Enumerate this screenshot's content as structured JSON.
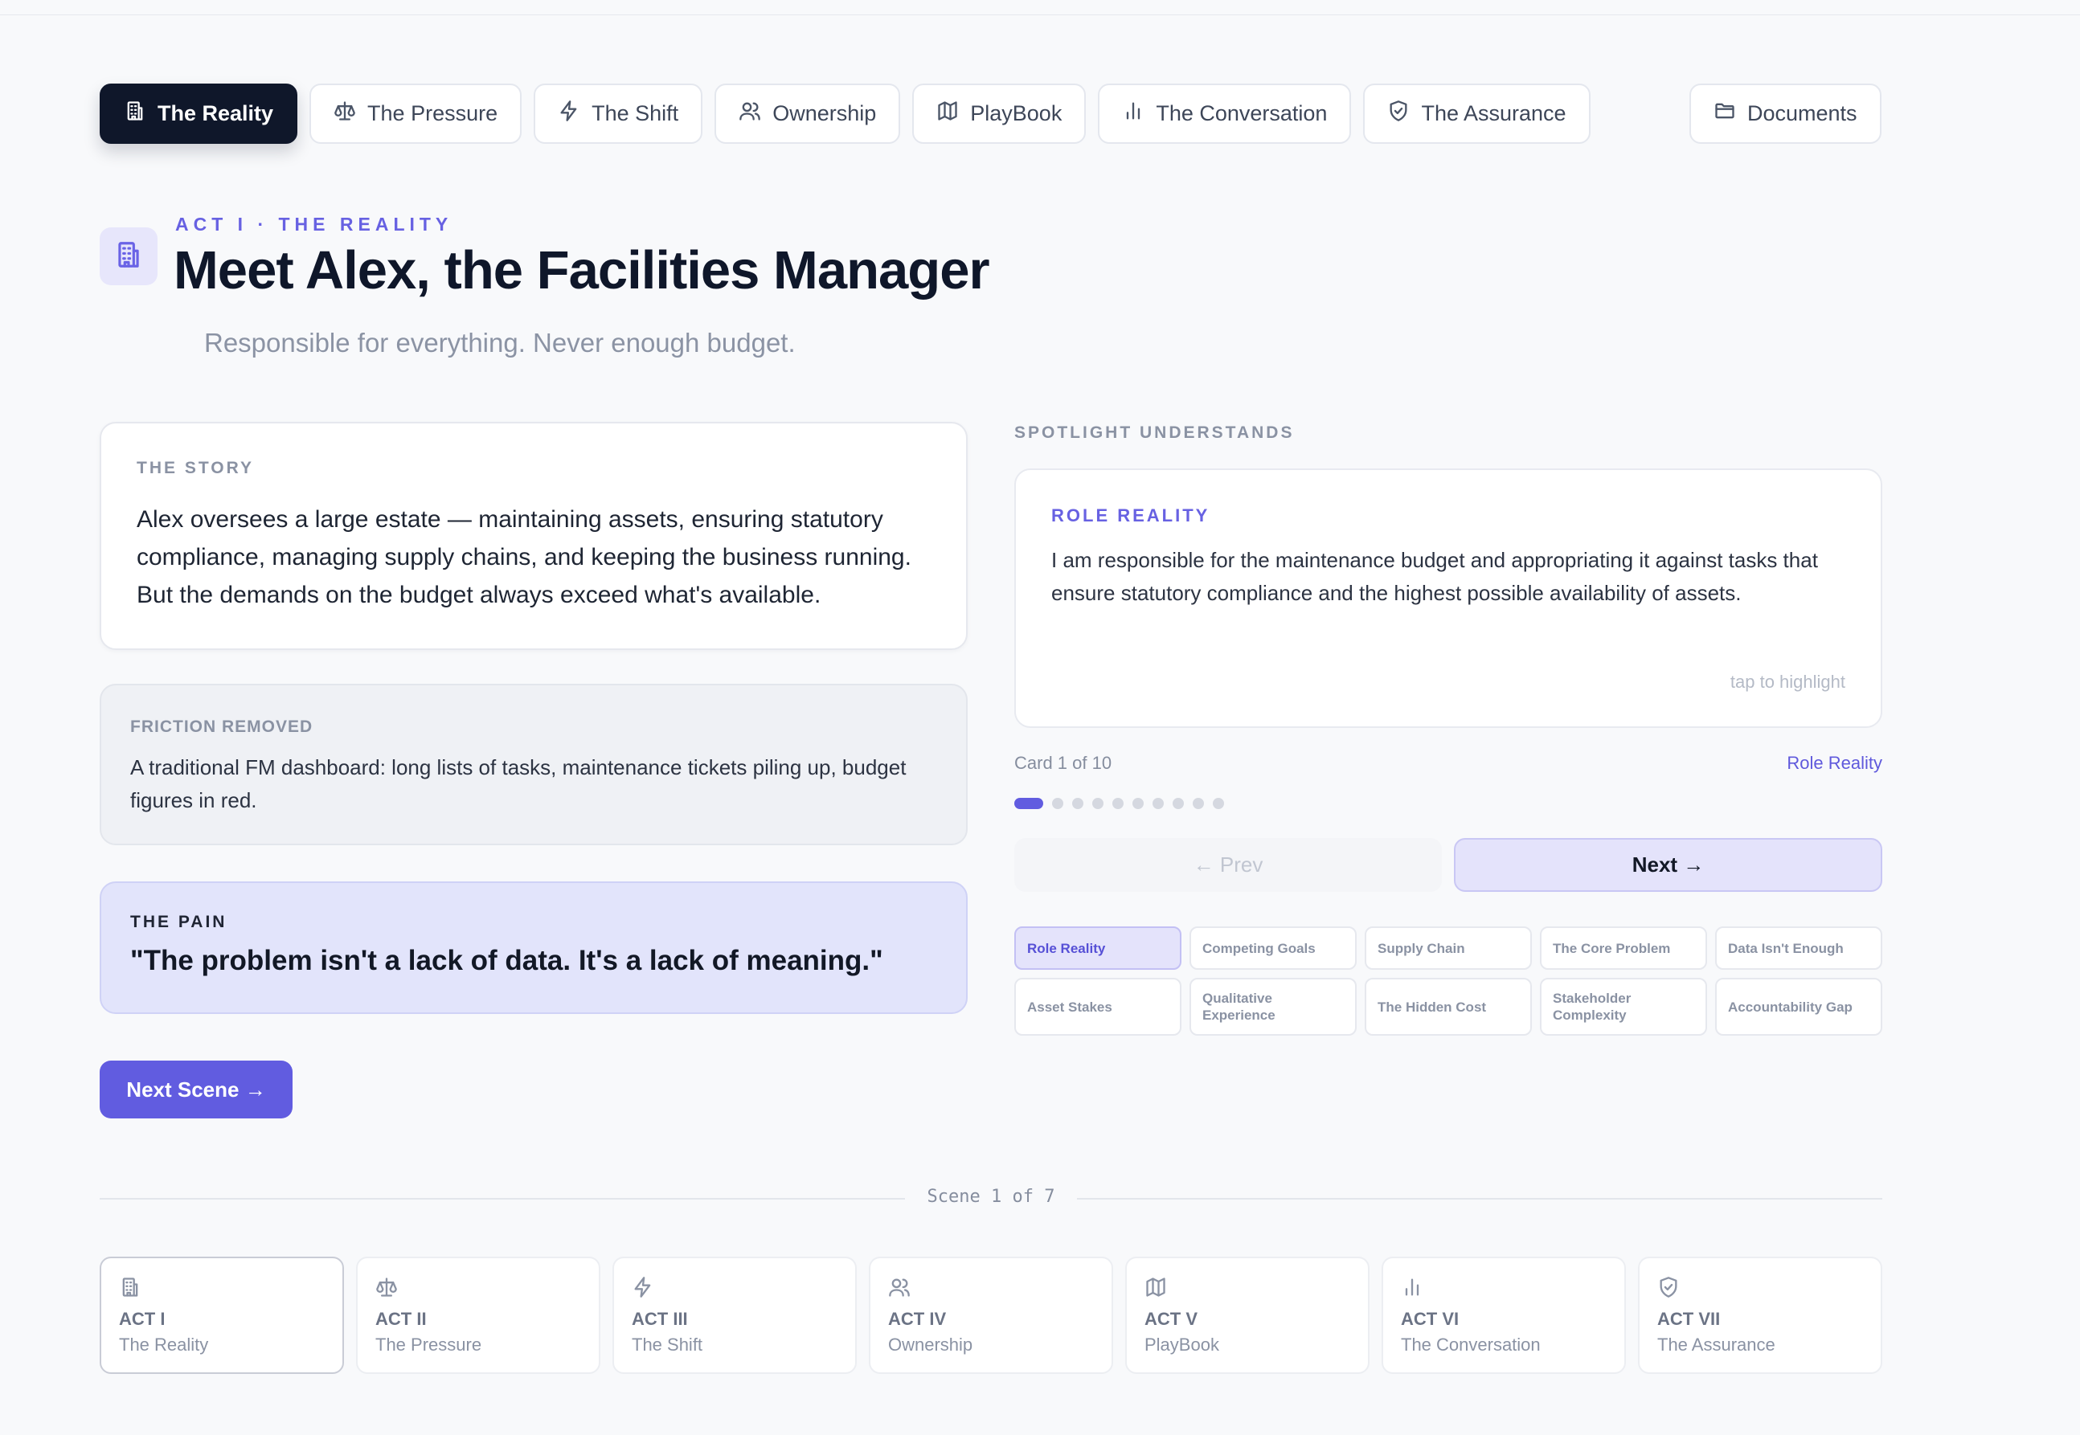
{
  "nav": {
    "items": [
      {
        "label": "The Reality",
        "icon": "building-icon",
        "active": true
      },
      {
        "label": "The Pressure",
        "icon": "scale-icon"
      },
      {
        "label": "The Shift",
        "icon": "lightning-icon"
      },
      {
        "label": "Ownership",
        "icon": "users-icon"
      },
      {
        "label": "PlayBook",
        "icon": "map-icon"
      },
      {
        "label": "The Conversation",
        "icon": "bar-chart-icon"
      },
      {
        "label": "The Assurance",
        "icon": "shield-icon"
      }
    ],
    "documents_label": "Documents"
  },
  "header": {
    "eyebrow": "ACT I · THE REALITY",
    "title": "Meet Alex, the Facilities Manager",
    "subtitle": "Responsible for everything. Never enough budget."
  },
  "story": {
    "label": "THE STORY",
    "text": "Alex oversees a large estate — maintaining assets, ensuring statutory compliance, managing supply chains, and keeping the business running. But the demands on the budget always exceed what's available."
  },
  "friction": {
    "label": "FRICTION REMOVED",
    "text": "A traditional FM dashboard: long lists of tasks, maintenance tickets piling up, budget figures in red."
  },
  "pain": {
    "label": "THE PAIN",
    "quote": "\"The problem isn't a lack of data. It's a lack of meaning.\""
  },
  "next_scene_label": "Next Scene →",
  "spotlight": {
    "label": "SPOTLIGHT UNDERSTANDS",
    "card_title": "ROLE REALITY",
    "card_text": "I am responsible for the maintenance budget and appropriating it against tasks that ensure statutory compliance and the highest possible availability of assets.",
    "tap_hint": "tap to highlight",
    "card_count": "Card 1 of 10",
    "current_card": "Role Reality",
    "current_index": 1,
    "total_cards": 10,
    "prev_label": "← Prev",
    "next_label": "Next →",
    "chips": [
      "Role Reality",
      "Competing Goals",
      "Supply Chain",
      "The Core Problem",
      "Data Isn't Enough",
      "Asset Stakes",
      "Qualitative Experience",
      "The Hidden Cost",
      "Stakeholder Complexity",
      "Accountability Gap"
    ]
  },
  "footer": {
    "scene_indicator": "Scene 1 of 7",
    "acts": [
      {
        "num": "ACT I",
        "name": "The Reality",
        "icon": "building-icon",
        "active": true
      },
      {
        "num": "ACT II",
        "name": "The Pressure",
        "icon": "scale-icon"
      },
      {
        "num": "ACT III",
        "name": "The Shift",
        "icon": "lightning-icon"
      },
      {
        "num": "ACT IV",
        "name": "Ownership",
        "icon": "users-icon"
      },
      {
        "num": "ACT V",
        "name": "PlayBook",
        "icon": "map-icon"
      },
      {
        "num": "ACT VI",
        "name": "The Conversation",
        "icon": "bar-chart-icon"
      },
      {
        "num": "ACT VII",
        "name": "The Assurance",
        "icon": "shield-icon"
      }
    ]
  },
  "colors": {
    "accent": "#615ce0",
    "dark": "#0f172a",
    "background": "#f8f9fb"
  }
}
